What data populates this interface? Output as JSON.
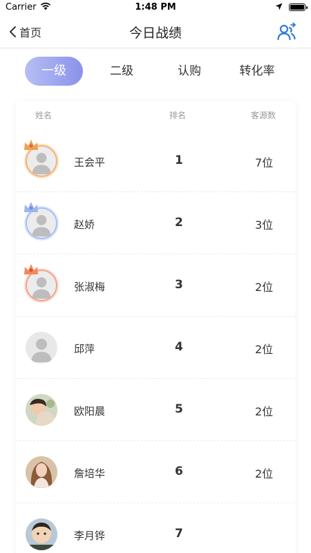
{
  "status_bar": {
    "carrier": "Carrier",
    "time": "1:48 PM"
  },
  "nav": {
    "back_label": "首页",
    "title": "今日战绩"
  },
  "tabs": [
    {
      "label": "一级",
      "active": true
    },
    {
      "label": "二级",
      "active": false
    },
    {
      "label": "认购",
      "active": false
    },
    {
      "label": "转化率",
      "active": false
    }
  ],
  "table": {
    "headers": {
      "name": "姓名",
      "rank": "排名",
      "count": "客源数"
    },
    "rows": [
      {
        "name": "王会平",
        "rank": "1",
        "count": "7位",
        "avatar": "default-avatar",
        "badge": "orange-crown-icon"
      },
      {
        "name": "赵娇",
        "rank": "2",
        "count": "3位",
        "avatar": "default-avatar",
        "badge": "blue-crown-icon"
      },
      {
        "name": "张淑梅",
        "rank": "3",
        "count": "2位",
        "avatar": "default-avatar",
        "badge": "red-crown-icon"
      },
      {
        "name": "邱萍",
        "rank": "4",
        "count": "2位",
        "avatar": "default-avatar",
        "badge": ""
      },
      {
        "name": "欧阳晨",
        "rank": "5",
        "count": "2位",
        "avatar": "photo-avatar",
        "badge": ""
      },
      {
        "name": "詹培华",
        "rank": "6",
        "count": "2位",
        "avatar": "photo-avatar",
        "badge": ""
      },
      {
        "name": "李月铧",
        "rank": "7",
        "count": "",
        "avatar": "photo-avatar",
        "badge": ""
      }
    ]
  },
  "colors": {
    "accent_start": "#b7bef4",
    "accent_end": "#8a92ea",
    "icon_blue": "#2f7bd8"
  }
}
